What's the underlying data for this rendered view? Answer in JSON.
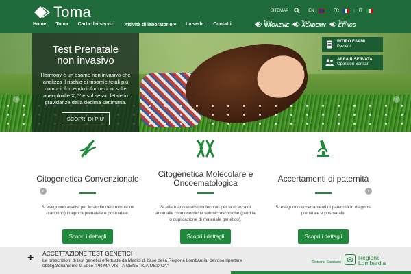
{
  "header": {
    "logo_text": "Toma",
    "sitemap": "SITEMAP",
    "lang_en": "EN",
    "lang_fr": "FR",
    "lang_it": "IT",
    "nav": [
      {
        "label": "Home"
      },
      {
        "label": "Toma"
      },
      {
        "label": "Carta dei servizi"
      },
      {
        "label": "Attività di laboratorio ▾"
      },
      {
        "label": "La sede"
      },
      {
        "label": "Contatti"
      }
    ],
    "brands": [
      {
        "small": "Toma",
        "big": "MAGAZINE"
      },
      {
        "small": "Toma",
        "big": "ACADEMY"
      },
      {
        "small": "Toma",
        "big": "ETHICS"
      }
    ]
  },
  "hero": {
    "title_line1": "Test Prenatale",
    "title_line2": "non invasivo",
    "text": "Harmony è un esame non invasivo che analizza il rischio di trisomie fetali più comuni, fornendo informazioni sulle aneuploidie X, Y e sul sesso fetale in gravidanze dalla decima settimana.",
    "button": "SCOPRI DI PIU'",
    "arrow_left": "‹",
    "arrow_right": "›",
    "quick_links": [
      {
        "title": "RITIRO ESAMI",
        "subtitle": "Pazienti"
      },
      {
        "title": "AREA RISERVATA",
        "subtitle": "Operatori Sanitari"
      }
    ]
  },
  "services": [
    {
      "title": "Citogenetica Convenzionale",
      "desc": "Si eseguono analisi per lo studio dei cromosomi (cariotipo) in epoca prenatale e postnatale.",
      "button": "Scopri i dettagli",
      "icon": "dna-icon"
    },
    {
      "title": "Citogenetica Molecolare e Oncoematologica",
      "desc": "Si effettuano analisi molecolari per la ricerca di anomalie cromosomiche submicroscopiche (perdita o duplicazione di materiale genetico).",
      "button": "Scopri i dettagli",
      "icon": "chromosome-icon"
    },
    {
      "title": "Accertamenti di paternità",
      "desc": "Si eseguono accertamenti di paternità in diagnosi prenatale e postnatale.",
      "button": "Scopri i dettagli",
      "icon": "microscope-icon"
    }
  ],
  "services_arrow_left": "‹",
  "services_arrow_right": "›",
  "bottom": {
    "plus": "+",
    "title": "ACCETTAZIONE TEST GENETICI",
    "text": "Le prescrizioni di test genetici effettuate da Medici di base della Regione Lombardia, devono riportare obbligatoriamente la voce \"PRIMA VISITA GENETICA MEDICA\"",
    "ss_label": "Sistema Sanitario",
    "region_line1": "Regione",
    "region_line2": "Lombardia"
  },
  "colors": {
    "header_green": "#1f6a3b",
    "accent_green": "#1f8a3c",
    "promo_overlay": "rgba(20,40,30,0.78)"
  }
}
